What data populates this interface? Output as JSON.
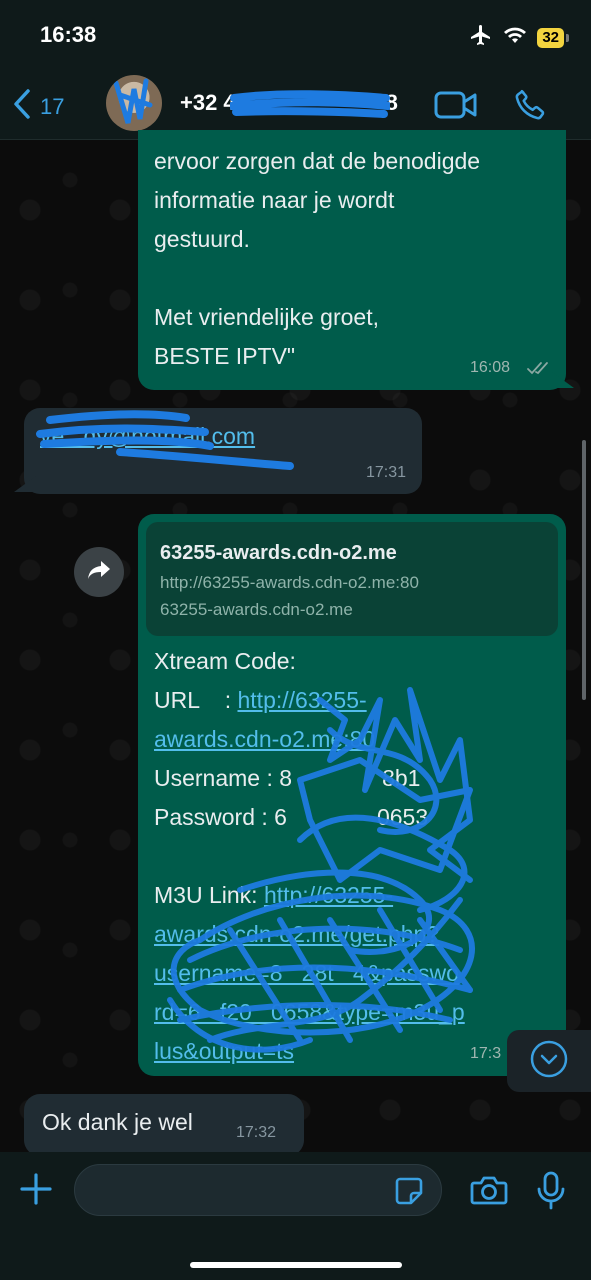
{
  "status_bar": {
    "time": "16:38",
    "battery": "32"
  },
  "header": {
    "back_count": "17",
    "contact_name": "+32 4",
    "contact_suffix": "8"
  },
  "messages": [
    {
      "direction": "outgoing",
      "text": "ervoor zorgen dat de benodigde\ninformatie naar je wordt\ngestuurd.\n\nMet vriendelijke groet,\nBESTE IPTV\"",
      "time": "16:08",
      "status": "read"
    },
    {
      "direction": "incoming",
      "text": "ve   dy@hotmail.com",
      "time": "17:31"
    },
    {
      "direction": "outgoing",
      "preview": {
        "title": "63255-awards.cdn-o2.me",
        "url": "http://63255-awards.cdn-o2.me:80",
        "domain": "63255-awards.cdn-o2.me"
      },
      "lines": [
        "Xtream Code:",
        "URL    : ",
        "http://63255-awards.cdn-o2.me:80",
        "Username : 8",
        "Password : 6",
        "",
        "M3U Link: ",
        "http://63255-awards.cdn-o2.me/get.php?username=8&password=6&type=m3u_plus&output=ts"
      ],
      "url_link": "http://63255-\nawards.cdn-o2.me:80",
      "username_visible": "8",
      "username_tail": "8b1",
      "password_visible": "6",
      "password_tail": "0653",
      "m3u_link": "http://63255-\nawards.cdn-o2.me/get.php?\nusername=8   28t   4&passwo\nrd=6   f20   0658&type=m3u_p\nlus&output=ts",
      "time": "17:3"
    },
    {
      "direction": "incoming",
      "text": "Ok dank je wel",
      "time": "17:32"
    }
  ],
  "input": {
    "placeholder": ""
  },
  "colors": {
    "accent": "#3a9fe0",
    "outgoing_bubble": "#005c4b",
    "incoming_bubble": "#202c33",
    "link": "#53bdeb",
    "scribble": "#1e7be0"
  },
  "icons": {
    "back": "chevron-left-icon",
    "video": "video-camera-icon",
    "call": "phone-icon",
    "forward": "forward-icon",
    "plus": "plus-icon",
    "sticker": "sticker-icon",
    "camera": "camera-icon",
    "mic": "microphone-icon",
    "scroll_down": "chevron-down-icon",
    "airplane": "airplane-icon",
    "wifi": "wifi-icon"
  }
}
